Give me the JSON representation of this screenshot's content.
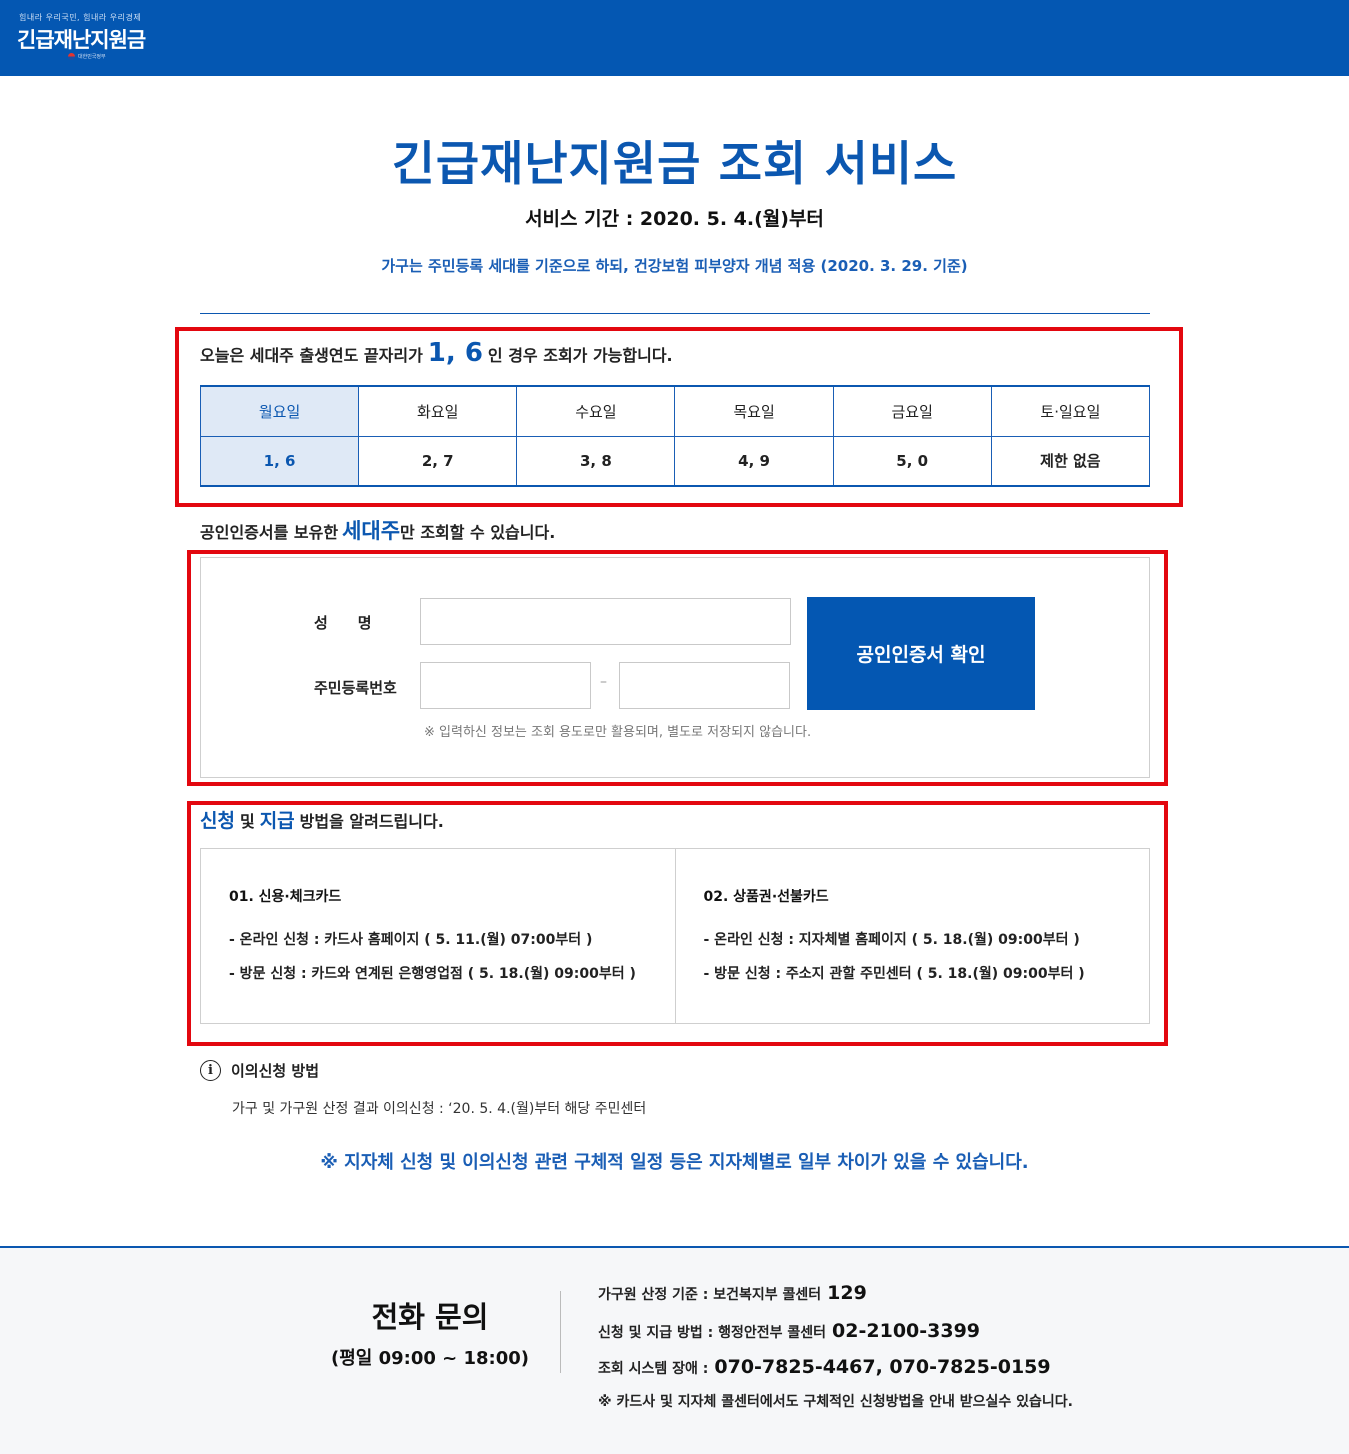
{
  "header": {
    "slogan": "힘내라 우리국민, 힘내라 우리경제",
    "logo_title": "긴급재난지원금",
    "gov_label": "대한민국정부"
  },
  "main": {
    "title": "긴급재난지원금 조회 서비스",
    "period": "서비스 기간 : 2020. 5. 4.(월)부터",
    "household_note": "가구는 주민등록 세대를 기준으로 하되, 건강보험 피부양자 개념 적용 (2020. 3. 29. 기준)"
  },
  "schedule": {
    "intro_before": "오늘은 세대주 출생연도 끝자리가",
    "intro_digits": "1, 6",
    "intro_after": "인 경우 조회가 가능합니다.",
    "days": [
      "월요일",
      "화요일",
      "수요일",
      "목요일",
      "금요일",
      "토·일요일"
    ],
    "digits": [
      "1, 6",
      "2, 7",
      "3, 8",
      "4, 9",
      "5, 0",
      "제한 없음"
    ],
    "active_index": 0
  },
  "cert_notice": {
    "before": "공인인증서를 보유한",
    "highlight": "세대주",
    "after": "만 조회할 수 있습니다."
  },
  "form": {
    "name_label": "성　　명",
    "rrn_label": "주민등록번호",
    "name_value": "",
    "rrn_front_value": "",
    "rrn_back_value": "",
    "dash": "–",
    "button_label": "공인인증서 확인",
    "note": "※ 입력하신 정보는 조회 용도로만 활용되며, 별도로 저장되지 않습니다."
  },
  "apply": {
    "word1": "신청",
    "mid": "및",
    "word2": "지급",
    "after": "방법을 알려드립니다.",
    "methods": [
      {
        "title": "01. 신용·체크카드",
        "online": "- 온라인 신청 : 카드사 홈페이지 ( 5. 11.(월) 07:00부터 )",
        "visit": "- 방문 신청 : 카드와 연계된 은행영업점 ( 5. 18.(월) 09:00부터 )"
      },
      {
        "title": "02. 상품권·선불카드",
        "online": "- 온라인 신청 : 지자체별 홈페이지 ( 5. 18.(월) 09:00부터 )",
        "visit": "- 방문 신청 : 주소지 관할 주민센터 ( 5. 18.(월) 09:00부터 )"
      }
    ]
  },
  "objection": {
    "icon": "info-icon",
    "title": "이의신청 방법",
    "detail": "가구 및 가구원 산정 결과 이의신청 : ‘20. 5. 4.(월)부터 해당 주민센터"
  },
  "bottom_note": "※ 지자체 신청 및 이의신청 관련 구체적 일정 등은 지자체별로 일부 차이가 있을 수 있습니다.",
  "footer": {
    "title": "전화 문의",
    "hours": "(평일 09:00 ~ 18:00)",
    "contacts": [
      {
        "label": "가구원 산정 기준 : 보건복지부 콜센터",
        "number": "129"
      },
      {
        "label": "신청 및 지급 방법 : 행정안전부 콜센터",
        "number": "02-2100-3399"
      },
      {
        "label": "조회 시스템 장애 :",
        "number": "070-7825-4467, 070-7825-0159"
      }
    ],
    "note": "※ 카드사 및 지자체 콜센터에서도 구체적인 신청방법을 안내 받으실수 있습니다."
  },
  "colors": {
    "brand_blue": "#0457b2",
    "title_blue": "#0b57b0",
    "highlight_red": "#e3070f",
    "active_day_bg": "#dfe9f6"
  }
}
